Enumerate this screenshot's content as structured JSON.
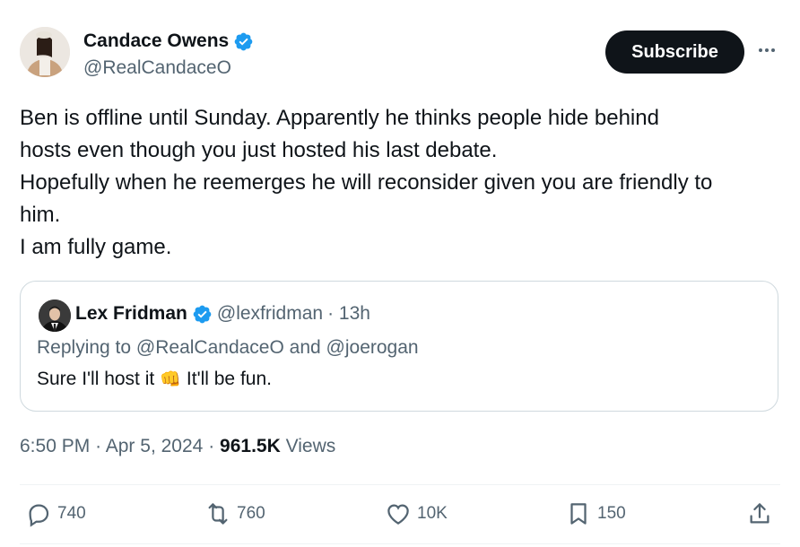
{
  "author": {
    "name": "Candace Owens",
    "handle": "@RealCandaceO"
  },
  "header": {
    "subscribe_label": "Subscribe"
  },
  "tweet": {
    "lines": [
      "Ben is offline until Sunday. Apparently he thinks people hide behind",
      "hosts even though you just hosted his last debate.",
      "Hopefully when he reemerges he will reconsider given you are friendly to",
      "him.",
      "I am fully game."
    ]
  },
  "quote": {
    "name": "Lex Fridman",
    "handle": "@lexfridman",
    "time": "· 13h",
    "replying_prefix": "Replying to",
    "mention_1": "@RealCandaceO",
    "and_word": "and",
    "mention_2": "@joerogan",
    "text_before": "Sure I'll host it",
    "emoji": "👊",
    "text_after": "It'll be fun."
  },
  "meta": {
    "time": "6:50 PM",
    "date": "Apr 5, 2024",
    "views_count": "961.5K",
    "views_label": "Views"
  },
  "actions": {
    "replies": "740",
    "reposts": "760",
    "likes": "10K",
    "bookmarks": "150"
  },
  "colors": {
    "verified_blue": "#1d9bf0",
    "text_primary": "#0f1419",
    "text_secondary": "#536471",
    "border": "#cfd9de"
  }
}
